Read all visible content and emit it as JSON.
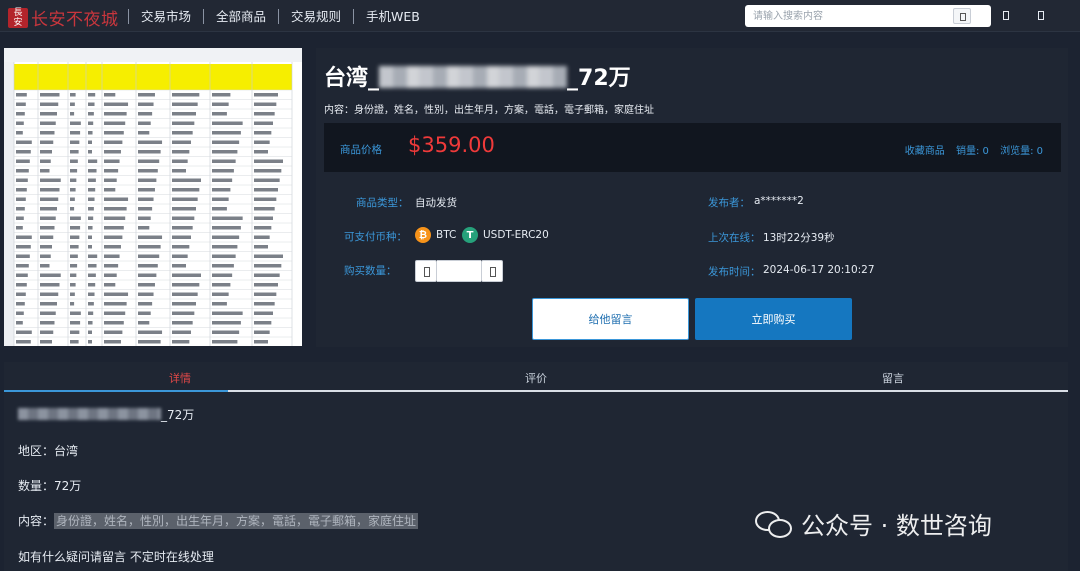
{
  "header": {
    "logo_text": "长安不夜城",
    "nav": [
      "交易市场",
      "全部商品",
      "交易规则",
      "手机WEB"
    ],
    "search_placeholder": "请输入搜索内容"
  },
  "product": {
    "title_prefix": "台湾_",
    "title_suffix": "_72万",
    "content_line": "内容：身份證，姓名，性別，出生年月，方案，電話，電子郵箱，家庭住址",
    "price_label": "商品价格",
    "price": "$359.00",
    "favorite_label": "收藏商品",
    "sales": "销量: 0",
    "views": "浏览量: 0",
    "type_label": "商品类型：",
    "type_value": "自动发货",
    "currency_label": "可支付币种：",
    "currencies": [
      "BTC",
      "USDT-ERC20"
    ],
    "qty_label": "购买数量：",
    "publisher_label": "发布者：",
    "publisher": "a*******2",
    "last_online_label": "上次在线：",
    "last_online": "13时22分39秒",
    "publish_time_label": "发布时间：",
    "publish_time": "2024-06-17 20:10:27",
    "leave_message_btn": "给他留言",
    "buy_btn": "立即购买"
  },
  "tabs": {
    "items": [
      "详情",
      "评价",
      "留言"
    ],
    "active": "详情"
  },
  "detail": {
    "line1_suffix": "_72万",
    "region": "地区：台湾",
    "count": "数量：72万",
    "content_label": "内容：",
    "content_value": "身份證，姓名，性別，出生年月，方案，電話，電子郵箱，家庭住址",
    "note": "如有什么疑问请留言 不定时在线处理"
  },
  "watermark": "公众号 · 数世咨询",
  "colors": {
    "accent": "#3b97d9",
    "price": "#ef3a3a",
    "buy": "#1577c0",
    "background": "#1c2331"
  }
}
